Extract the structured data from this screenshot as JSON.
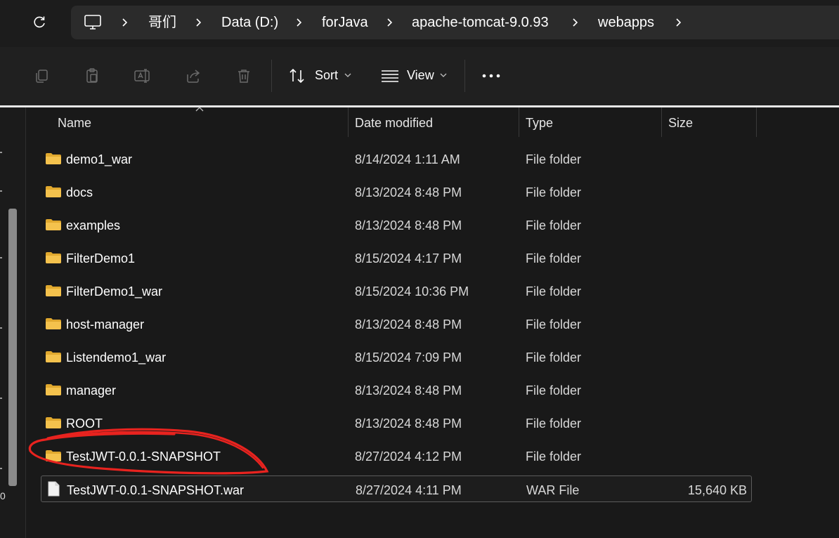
{
  "breadcrumb": {
    "items": [
      "哥们",
      "Data (D:)",
      "forJava",
      "apache-tomcat-9.0.93",
      "webapps"
    ]
  },
  "toolbar": {
    "sort_label": "Sort",
    "view_label": "View",
    "icons": [
      "copy-icon",
      "paste-icon",
      "rename-icon",
      "share-icon",
      "delete-icon",
      "sort-icon",
      "view-icon",
      "more-icon"
    ]
  },
  "columns": {
    "name": "Name",
    "date": "Date modified",
    "type": "Type",
    "size": "Size"
  },
  "files": [
    {
      "name": "demo1_war",
      "date": "8/14/2024 1:11 AM",
      "type": "File folder",
      "size": "",
      "kind": "folder"
    },
    {
      "name": "docs",
      "date": "8/13/2024 8:48 PM",
      "type": "File folder",
      "size": "",
      "kind": "folder"
    },
    {
      "name": "examples",
      "date": "8/13/2024 8:48 PM",
      "type": "File folder",
      "size": "",
      "kind": "folder"
    },
    {
      "name": "FilterDemo1",
      "date": "8/15/2024 4:17 PM",
      "type": "File folder",
      "size": "",
      "kind": "folder"
    },
    {
      "name": "FilterDemo1_war",
      "date": "8/15/2024 10:36 PM",
      "type": "File folder",
      "size": "",
      "kind": "folder"
    },
    {
      "name": "host-manager",
      "date": "8/13/2024 8:48 PM",
      "type": "File folder",
      "size": "",
      "kind": "folder"
    },
    {
      "name": "Listendemo1_war",
      "date": "8/15/2024 7:09 PM",
      "type": "File folder",
      "size": "",
      "kind": "folder"
    },
    {
      "name": "manager",
      "date": "8/13/2024 8:48 PM",
      "type": "File folder",
      "size": "",
      "kind": "folder"
    },
    {
      "name": "ROOT",
      "date": "8/13/2024 8:48 PM",
      "type": "File folder",
      "size": "",
      "kind": "folder"
    },
    {
      "name": "TestJWT-0.0.1-SNAPSHOT",
      "date": "8/27/2024 4:12 PM",
      "type": "File folder",
      "size": "",
      "kind": "folder"
    },
    {
      "name": "TestJWT-0.0.1-SNAPSHOT.war",
      "date": "8/27/2024 4:11 PM",
      "type": "WAR File",
      "size": "15,640 KB",
      "kind": "file"
    }
  ],
  "colors": {
    "folder": "#f4c24d",
    "annotation": "#e8231f"
  },
  "nav": {
    "edge_digit": "0"
  }
}
